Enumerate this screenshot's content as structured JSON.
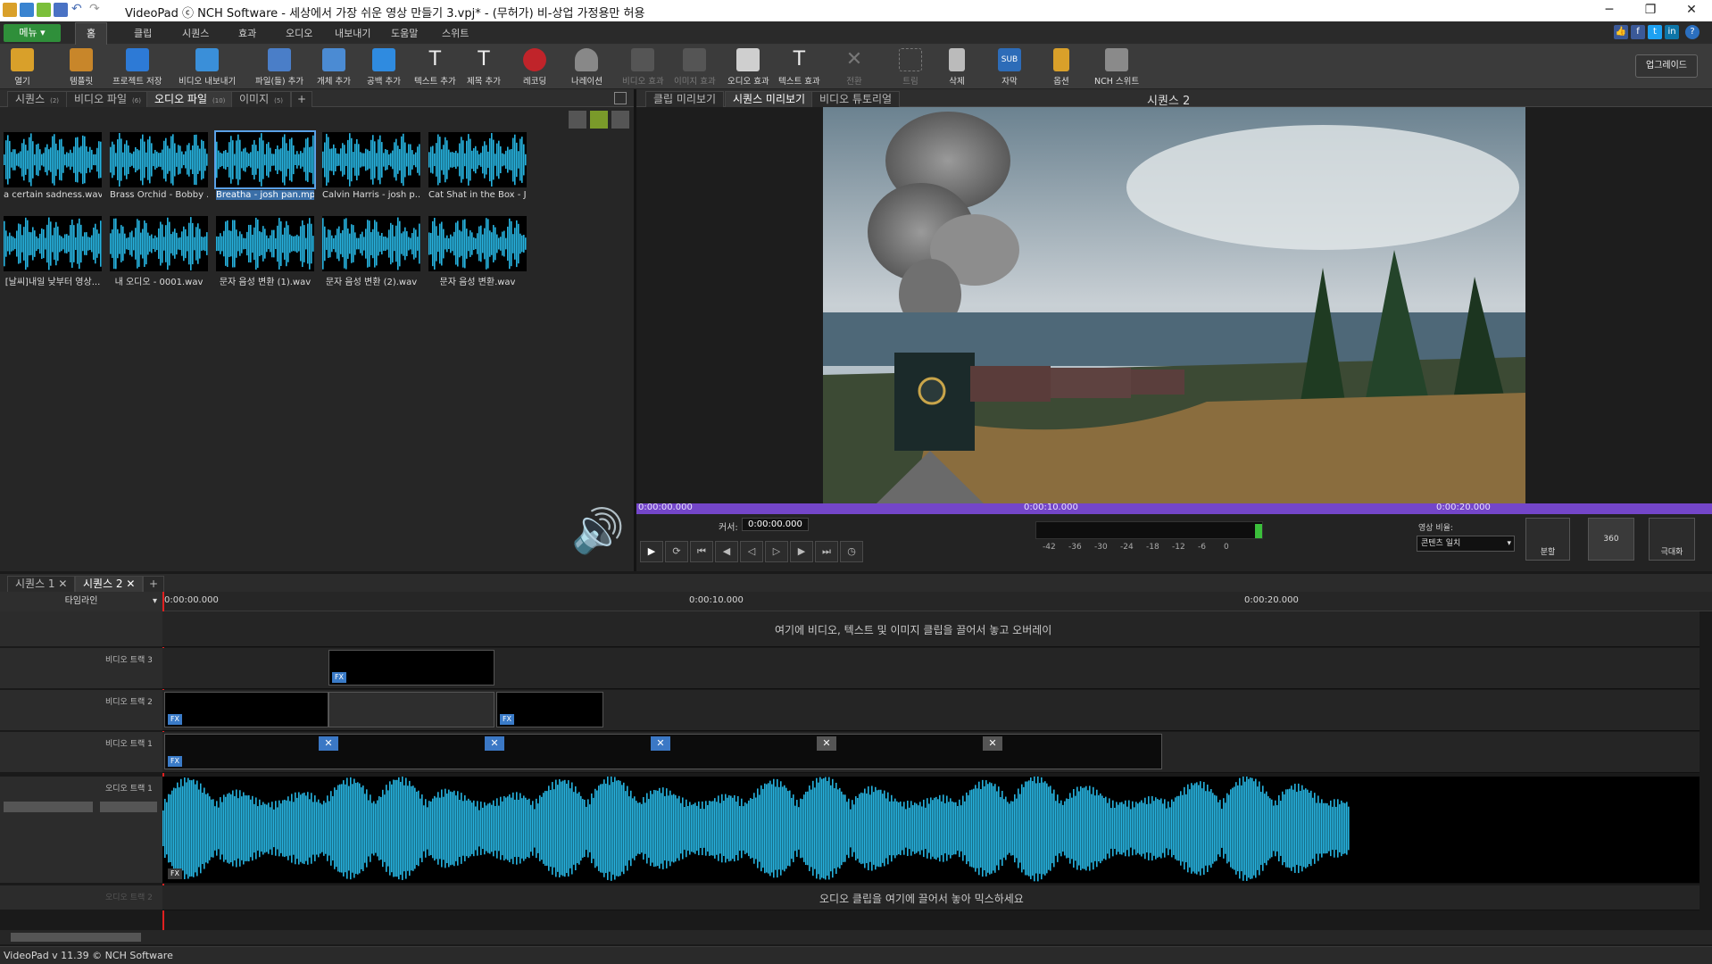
{
  "window": {
    "title": "VideoPad ⓒ NCH Software - 세상에서 가장 쉬운 영상 만들기 3.vpj* - (무허가) 비-상업 가정용만 허용"
  },
  "menu": {
    "button": "메뉴 ▾",
    "tabs": [
      "홈",
      "클립",
      "시퀀스",
      "효과",
      "오디오",
      "내보내기",
      "도움말",
      "스위트"
    ]
  },
  "toolbar": {
    "items": [
      "열기",
      "템플릿",
      "프로젝트 저장",
      "비디오 내보내기",
      "파일(들) 추가",
      "개체 추가",
      "공백 추가",
      "텍스트 추가",
      "제목 추가",
      "레코딩",
      "나레이션",
      "비디오 효과",
      "이미지 효과",
      "오디오 효과",
      "텍스트 효과",
      "전환",
      "트림",
      "삭제",
      "자막",
      "옵션",
      "NCH 스위트"
    ],
    "upgrade": "업그레이드"
  },
  "bin": {
    "tabs": [
      {
        "label": "시퀀스",
        "count": "(2)"
      },
      {
        "label": "비디오 파일",
        "count": "(6)"
      },
      {
        "label": "오디오 파일",
        "count": "(10)"
      },
      {
        "label": "이미지",
        "count": "(5)"
      }
    ],
    "add": "+",
    "clips": [
      "a certain sadness.wav",
      "Brass Orchid - Bobby ...",
      "Breatha - josh pan.mp3",
      "Calvin Harris - josh p...",
      "Cat Shat in the Box - J...",
      "[날씨]내일 낮부터 영상...",
      "내 오디오 - 0001.wav",
      "문자 음성 변환 (1).wav",
      "문자 음성 변환 (2).wav",
      "문자 음성 변환.wav"
    ]
  },
  "preview": {
    "tabs": [
      "클립 미리보기",
      "시퀀스 미리보기",
      "비디오 튜토리얼"
    ],
    "sequence_label": "시퀀스 2",
    "timeline_marks": [
      "0:00:00.000",
      "0:00:10.000",
      "0:00:20.000"
    ],
    "cursor_label": "커서:",
    "cursor_value": "0:00:00.000",
    "meter_labels": [
      "-42",
      "-36",
      "-30",
      "-24",
      "-18",
      "-12",
      "-6",
      "0"
    ],
    "aspect_label": "영상 비율:",
    "aspect_value": "콘텐츠 일치",
    "split": "분할",
    "b360": "360",
    "fullscreen": "극대화"
  },
  "timeline": {
    "seq_tabs": [
      "시퀀스 1",
      "시퀀스 2"
    ],
    "add": "+",
    "ruler_label": "타임라인",
    "ruler_marks": [
      "0:00:00.000",
      "0:00:10.000",
      "0:00:20.000"
    ],
    "overlay_hint": "여기에 비디오, 텍스트 및 이미지 클립을 끌어서 놓고 오버레이",
    "tracks": [
      "비디오 트랙 3",
      "비디오 트랙 2",
      "비디오 트랙 1",
      "오디오 트랙 1",
      "오디오 트랙 2"
    ],
    "audio_hint": "오디오 클립을 여기에 끌어서 놓아 믹스하세요",
    "fx": "FX"
  },
  "status": {
    "text": "VideoPad v 11.39 © NCH Software"
  },
  "colors": {
    "accent_green": "#2f8f3a",
    "waveform": "#27b3e0",
    "timeline_bar": "#7446c9",
    "selection": "#3a6fa8"
  }
}
